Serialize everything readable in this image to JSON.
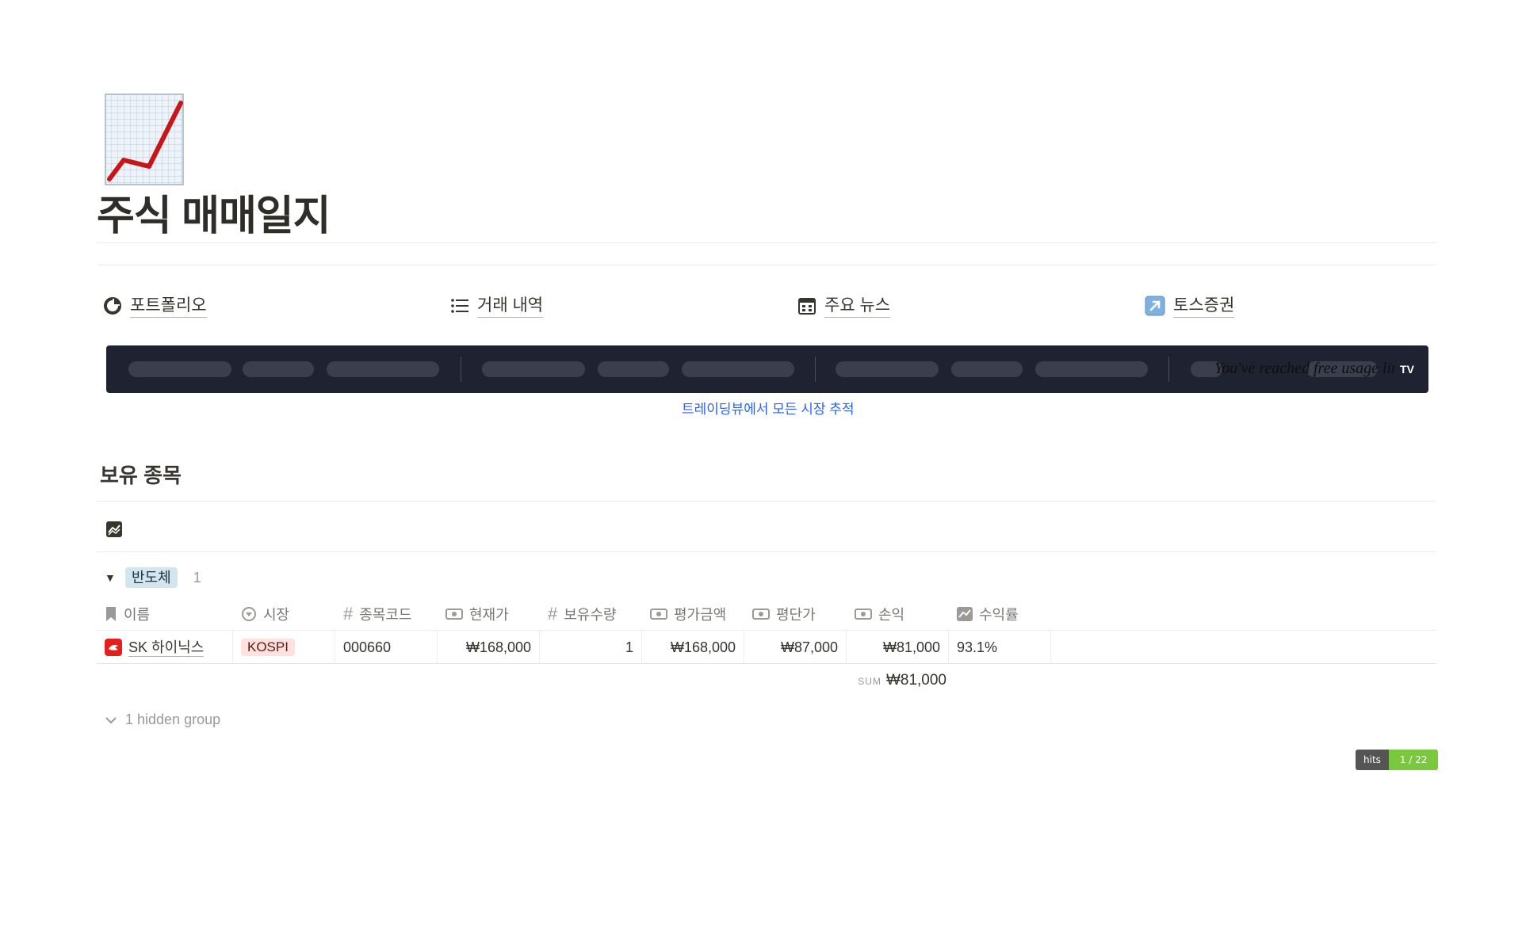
{
  "page": {
    "title": "주식 매매일지",
    "icon": "chart-increasing-icon"
  },
  "links": [
    {
      "label": "포트폴리오",
      "icon": "pie-chart-icon"
    },
    {
      "label": "거래 내역",
      "icon": "list-icon"
    },
    {
      "label": "주요 뉴스",
      "icon": "calendar-icon"
    },
    {
      "label": "토스증권",
      "icon": "arrow-link-icon"
    }
  ],
  "ticker": {
    "limit_message": "You've reached free usage limit",
    "logo": "TV",
    "link_text": "트레이딩뷰에서 모든 시장 추적"
  },
  "section": {
    "title": "보유 종목",
    "view_icon": "chart-line-icon"
  },
  "group": {
    "name": "반도체",
    "count": "1"
  },
  "table": {
    "columns": [
      "이름",
      "시장",
      "종목코드",
      "현재가",
      "보유수량",
      "평가금액",
      "평단가",
      "손익",
      "수익률"
    ],
    "rows": [
      {
        "name": "SK 하이닉스",
        "market": "KOSPI",
        "code": "000660",
        "current_price": "₩168,000",
        "quantity": "1",
        "valuation": "₩168,000",
        "avg_price": "₩87,000",
        "profit": "₩81,000",
        "return_rate": "93.1%"
      }
    ],
    "sum_label": "SUM",
    "sum_value": "₩81,000"
  },
  "hidden_group": "1 hidden group",
  "hits": {
    "label": "hits",
    "value": "1 / 22"
  },
  "colors": {
    "accent_link": "#2962ff",
    "group_tag_bg": "#d3e5ef",
    "market_tag_bg": "#ffe2dd",
    "return_text": "#d44c47",
    "ticker_bg": "#1f2230"
  }
}
